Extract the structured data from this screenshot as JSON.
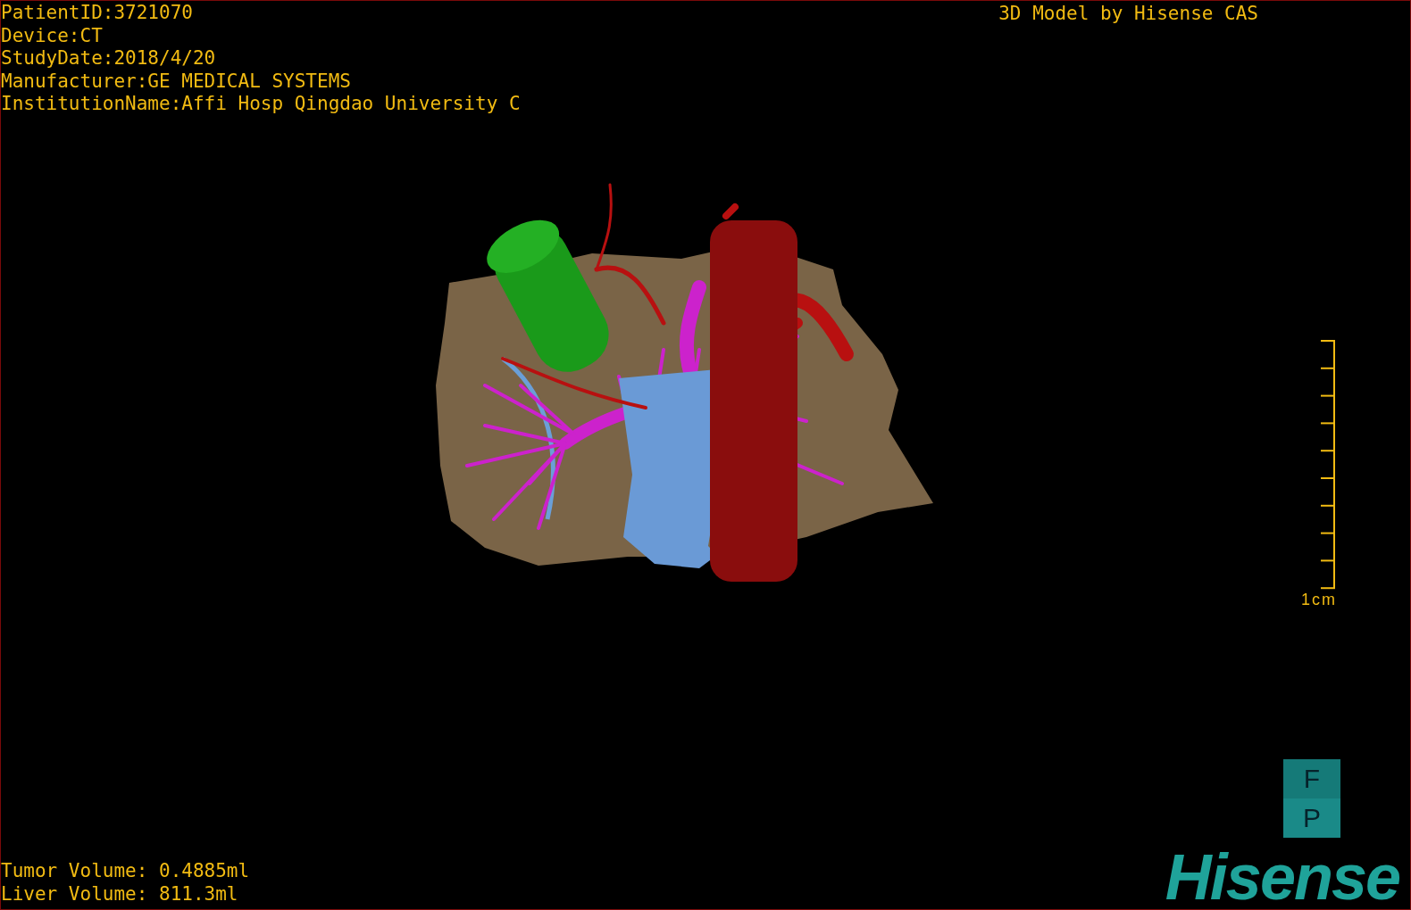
{
  "patient_info": [
    "PatientID:3721070",
    "Device:CT",
    "StudyDate:2018/4/20",
    "Manufacturer:GE MEDICAL SYSTEMS",
    "InstitutionName:Affi Hosp Qingdao University C"
  ],
  "title": "3D Model by Hisense CAS",
  "scale_bar": {
    "label": "1cm"
  },
  "orientation_cube": {
    "top": "F",
    "bottom": "P"
  },
  "volumes": [
    "Tumor Volume: 0.4885ml",
    "Liver Volume: 811.3ml"
  ],
  "logo": "Hisense"
}
